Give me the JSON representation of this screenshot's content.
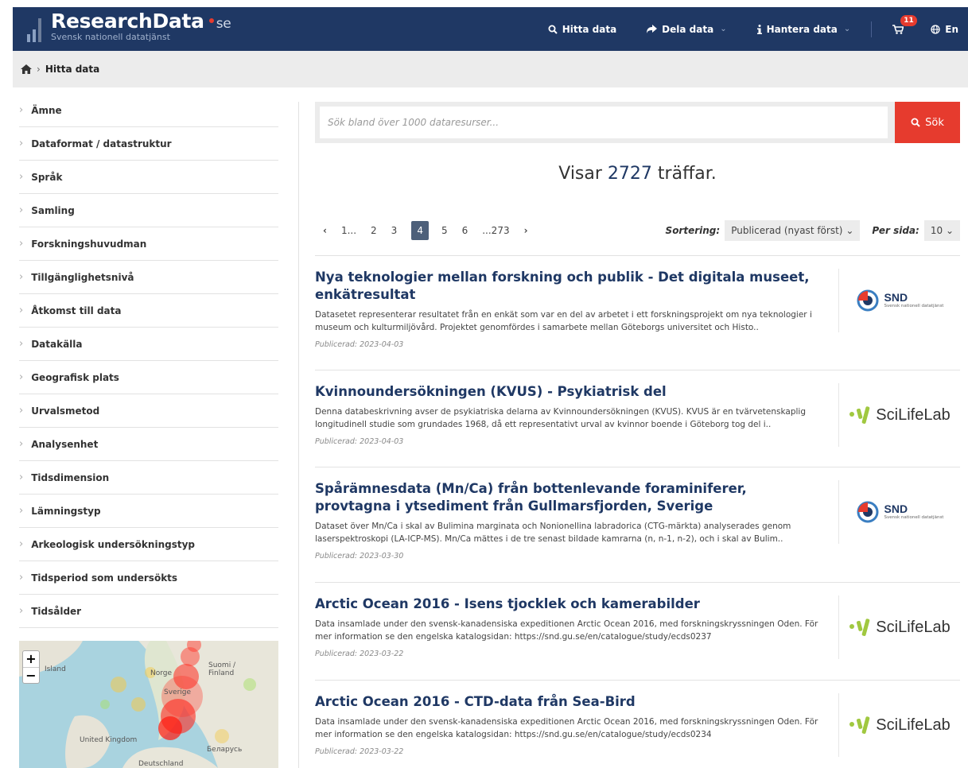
{
  "header": {
    "brand": "ResearchData",
    "brand_tld": "se",
    "tagline": "Svensk nationell datatjänst",
    "nav": {
      "find": "Hitta data",
      "share": "Dela data",
      "manage": "Hantera data",
      "cart_count": "11",
      "language": "En"
    }
  },
  "breadcrumb": {
    "current": "Hitta data"
  },
  "facets": [
    "Ämne",
    "Dataformat / datastruktur",
    "Språk",
    "Samling",
    "Forskningshuvudman",
    "Tillgänglighetsnivå",
    "Åtkomst till data",
    "Datakälla",
    "Geografisk plats",
    "Urvalsmetod",
    "Analysenhet",
    "Tidsdimension",
    "Lämningstyp",
    "Arkeologisk undersökningstyp",
    "Tidsperiod som undersökts",
    "Tidsålder"
  ],
  "map": {
    "labels": {
      "iceland": "Island",
      "norway": "Norge",
      "finland": "Suomi / Finland",
      "sweden": "Sverige",
      "uk": "United Kingdom",
      "belarus": "Беларусь",
      "germany": "Deutschland"
    },
    "zoom_in": "+",
    "zoom_out": "−"
  },
  "search": {
    "placeholder": "Sök bland över 1000 dataresurser...",
    "button": "Sök"
  },
  "hits": {
    "prefix": "Visar",
    "count": "2727",
    "suffix": "träffar."
  },
  "pagination": {
    "prev": "‹",
    "pages": [
      "1...",
      "2",
      "3",
      "4",
      "5",
      "6",
      "...273"
    ],
    "active": "4",
    "next": "›"
  },
  "sorting": {
    "label": "Sortering:",
    "value": "Publicerad (nyast först)",
    "per_page_label": "Per sida:",
    "per_page_value": "10"
  },
  "results": [
    {
      "title": "Nya teknologier mellan forskning och publik - Det digitala museet, enkätresultat",
      "description": "Datasetet representerar resultatet från en enkät som var en del av arbetet i ett forskningsprojekt om nya teknologier i museum och kulturmiljövård. Projektet genomfördes i samarbete mellan Göteborgs universitet och Histo..",
      "date": "Publicerad: 2023-04-03",
      "publisher": "snd"
    },
    {
      "title": "Kvinnoundersökningen (KVUS) - Psykiatrisk del",
      "description": "Denna databeskrivning avser de psykiatriska delarna av Kvinnoundersökningen (KVUS). KVUS är en tvärvetenskaplig longitudinell studie som grundades 1968, då ett representativt urval av kvinnor boende i Göteborg tog del i..",
      "date": "Publicerad: 2023-04-03",
      "publisher": "scilifelab"
    },
    {
      "title": "Spårämnesdata (Mn/Ca) från bottenlevande foraminiferer, provtagna i ytsediment från Gullmarsfjorden, Sverige",
      "description": "Dataset över Mn/Ca i skal av Bulimina marginata och Nonionellina labradorica (CTG-märkta) analyserades genom laserspektroskopi (LA-ICP-MS). Mn/Ca mättes i de tre senast bildade kamrarna (n, n-1, n-2), och i skal av Bulim..",
      "date": "Publicerad: 2023-03-30",
      "publisher": "snd"
    },
    {
      "title": "Arctic Ocean 2016 - Isens tjocklek och kamerabilder",
      "description": "Data insamlade under den svensk-kanadensiska expeditionen Arctic Ocean 2016, med forskningskryssningen Oden. För mer information se den engelska katalogsidan: https://snd.gu.se/en/catalogue/study/ecds0237",
      "date": "Publicerad: 2023-03-22",
      "publisher": "scilifelab"
    },
    {
      "title": "Arctic Ocean 2016 - CTD-data från Sea-Bird",
      "description": "Data insamlade under den svensk-kanadensiska expeditionen Arctic Ocean 2016, med forskningskryssningen Oden. För mer information se den engelska katalogsidan: https://snd.gu.se/en/catalogue/study/ecds0234",
      "date": "Publicerad: 2023-03-22",
      "publisher": "scilifelab"
    }
  ],
  "logos": {
    "snd": {
      "name": "SND",
      "sub": "Svensk nationell datatjänst"
    },
    "scilifelab": {
      "name": "SciLifeLab"
    }
  },
  "colors": {
    "header": "#1f3864",
    "accent": "#e63b2e",
    "link": "#1f3864"
  }
}
